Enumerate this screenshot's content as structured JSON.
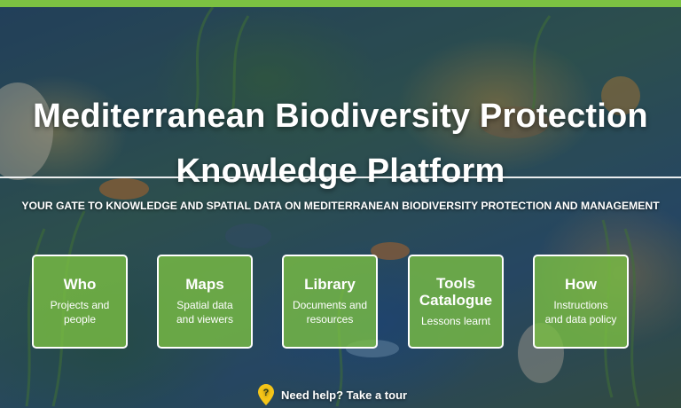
{
  "header": {
    "title_line1": "Mediterranean Biodiversity Protection",
    "title_line2": "Knowledge Platform",
    "tagline": "YOUR GATE TO KNOWLEDGE AND SPATIAL DATA ON MEDITERRANEAN BIODIVERSITY PROTECTION AND MANAGEMENT"
  },
  "cards": [
    {
      "title": "Who",
      "desc_line1": "Projects and",
      "desc_line2": "people"
    },
    {
      "title": "Maps",
      "desc_line1": "Spatial data",
      "desc_line2": "and viewers"
    },
    {
      "title": "Library",
      "desc_line1": "Documents and",
      "desc_line2": "resources"
    },
    {
      "title_line1": "Tools",
      "title_line2": "Catalogue",
      "desc_line1": "Lessons learnt"
    },
    {
      "title": "How",
      "desc_line1": "Instructions",
      "desc_line2": "and data policy"
    }
  ],
  "help": {
    "label": "Need help? Take a tour",
    "icon": "question-pin-icon"
  },
  "colors": {
    "accent": "#7cc242",
    "card_bg": "rgba(124,194,66,0.78)",
    "help_icon": "#f5c518"
  }
}
